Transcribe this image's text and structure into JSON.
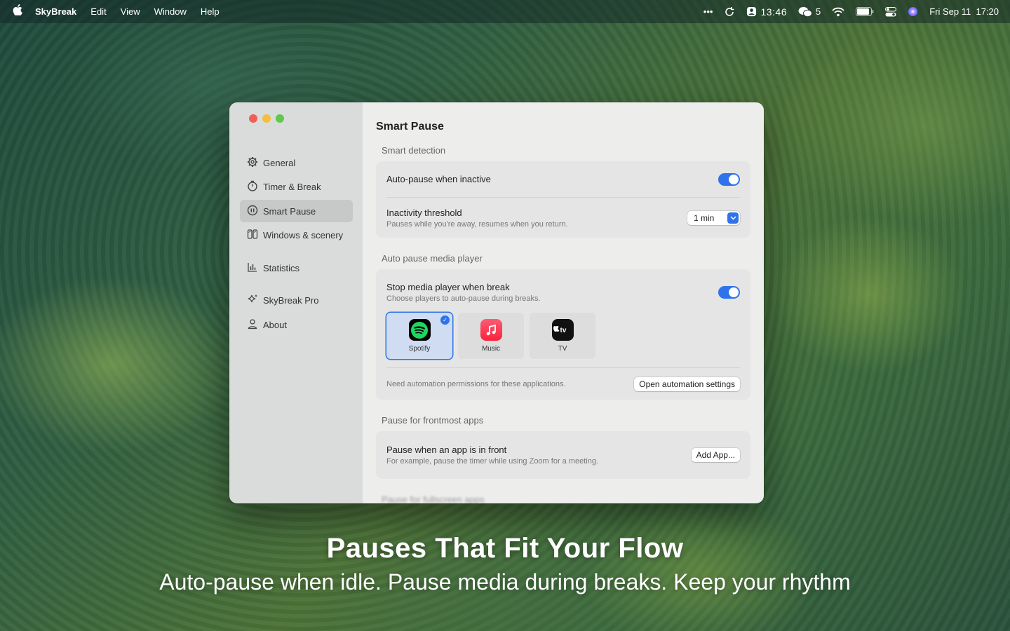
{
  "menubar": {
    "apple_icon": "apple-logo-icon",
    "app_name": "SkyBreak",
    "menus": [
      "Edit",
      "View",
      "Window",
      "Help"
    ],
    "more_icon": "•••",
    "timer": "13:46",
    "wechat_count": "5",
    "datetime": "Fri Sep 11  17:20"
  },
  "sidebar": {
    "items": [
      {
        "label": "General",
        "icon": "gear-icon"
      },
      {
        "label": "Timer & Break",
        "icon": "stopwatch-icon"
      },
      {
        "label": "Smart Pause",
        "icon": "pause-circle-icon"
      },
      {
        "label": "Windows & scenery",
        "icon": "windows-icon"
      },
      {
        "label": "Statistics",
        "icon": "chart-icon"
      },
      {
        "label": "SkyBreak Pro",
        "icon": "sparkle-icon"
      },
      {
        "label": "About",
        "icon": "person-icon"
      }
    ]
  },
  "content": {
    "title": "Smart Pause",
    "smart_detection": {
      "section": "Smart detection",
      "auto_pause_label": "Auto-pause when inactive",
      "auto_pause_on": true,
      "threshold_label": "Inactivity threshold",
      "threshold_sub": "Pauses while you're away, resumes when you return.",
      "threshold_value": "1 min"
    },
    "media": {
      "section": "Auto pause media player",
      "stop_label": "Stop media player when break",
      "stop_sub": "Choose players to auto-pause during breaks.",
      "stop_on": true,
      "players": [
        {
          "name": "Spotify",
          "selected": true
        },
        {
          "name": "Music",
          "selected": false
        },
        {
          "name": "TV",
          "selected": false
        }
      ],
      "permission_note": "Need automation permissions for these applications.",
      "open_settings_button": "Open automation settings"
    },
    "frontmost": {
      "section": "Pause for frontmost apps",
      "label": "Pause when an app is in front",
      "sub": "For example, pause the timer while using Zoom for a meeting.",
      "add_button": "Add App..."
    },
    "fullscreen_section": "Pause for fullscreen apps"
  },
  "caption": {
    "title": "Pauses That Fit Your Flow",
    "subtitle": "Auto-pause when idle. Pause media during breaks. Keep your rhythm"
  },
  "colors": {
    "accent": "#2f73ea",
    "sidebar_bg": "#d9dcdb",
    "content_bg": "#ededec"
  }
}
